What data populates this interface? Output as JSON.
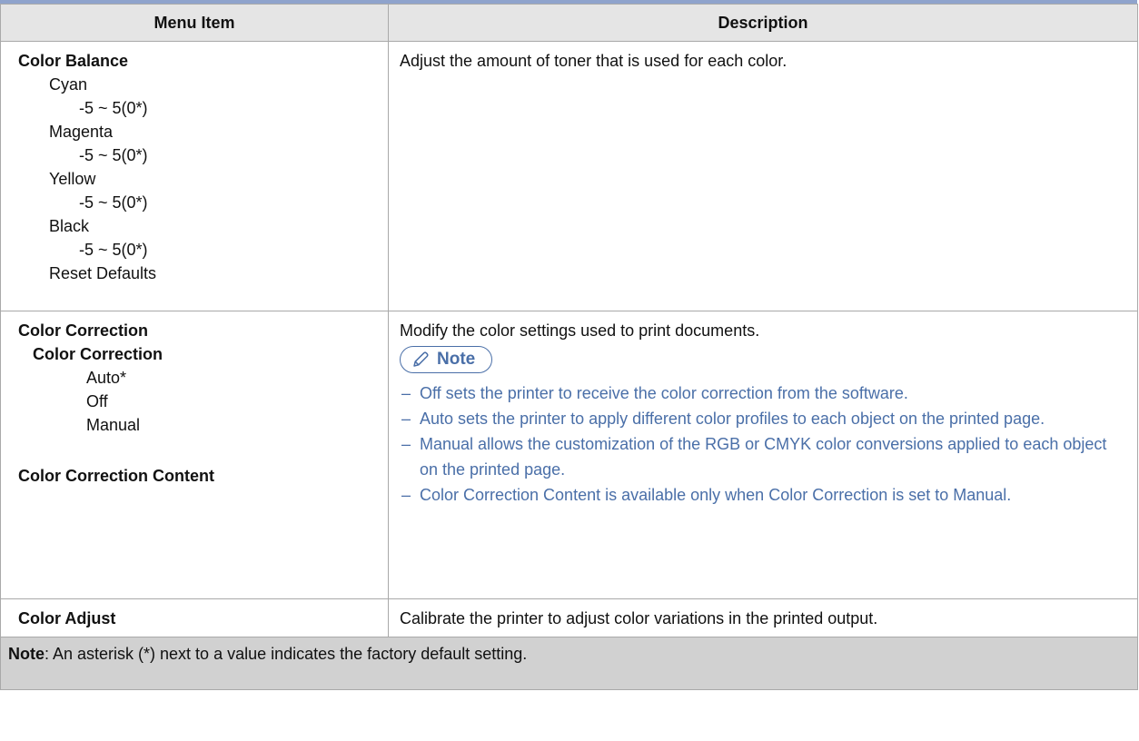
{
  "header": {
    "col1": "Menu Item",
    "col2": "Description"
  },
  "rows": [
    {
      "menu": [
        {
          "text": "Color Balance",
          "level": 0,
          "bold": true
        },
        {
          "text": "Cyan",
          "level": 1
        },
        {
          "text": "-5 ~ 5(0*)",
          "level": 2
        },
        {
          "text": "Magenta",
          "level": 1
        },
        {
          "text": "-5 ~ 5(0*)",
          "level": 2
        },
        {
          "text": "Yellow",
          "level": 1
        },
        {
          "text": "-5 ~ 5(0*)",
          "level": 2
        },
        {
          "text": "Black",
          "level": 1
        },
        {
          "text": "-5 ~ 5(0*)",
          "level": 2
        },
        {
          "text": "Reset Defaults",
          "level": 1
        }
      ],
      "description": "Adjust the amount of toner that is used for each color."
    },
    {
      "menu": {
        "title": "Color Correction",
        "sub_title": "Color Correction",
        "options": [
          "Auto*",
          "Off",
          "Manual"
        ],
        "content": "Color Correction Content"
      },
      "description": "Modify the color settings used to print documents.",
      "note": {
        "label": "Note",
        "icon": "pencil-icon",
        "dash": "–",
        "items": [
          "Off sets the printer to receive the color correction from the software.",
          "Auto sets the printer to apply different color profiles to each object on the printed page.",
          "Manual allows the customization of the RGB or CMYK color conversions applied to each object on the printed page.",
          "Color Correction Content is available only when Color Correction is set to Manual."
        ]
      }
    },
    {
      "menu": {
        "title": "Color Adjust"
      },
      "description": "Calibrate the printer to adjust color variations in the printed output."
    }
  ],
  "footer": {
    "label": "Note",
    "text": ": An asterisk (*) next to a value indicates the factory default setting."
  },
  "colors": {
    "header_bg": "#e5e5e5",
    "footer_bg": "#d1d1d1",
    "note_blue": "#4a6fa8",
    "top_rule": "#8fa3cc"
  }
}
